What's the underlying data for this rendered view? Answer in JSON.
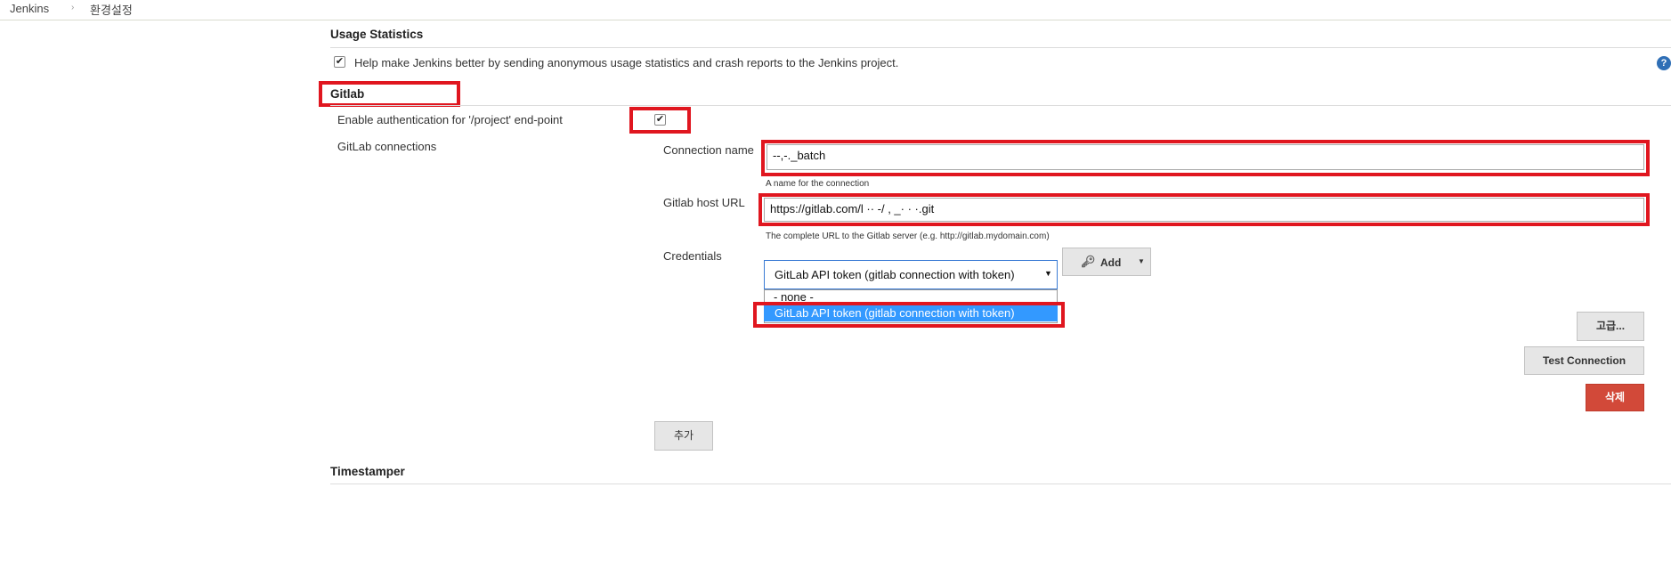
{
  "breadcrumb": {
    "home": "Jenkins",
    "separator": "›",
    "current": "환경설정"
  },
  "usage": {
    "title": "Usage Statistics",
    "checkbox_text": "Help make Jenkins better by sending anonymous usage statistics and crash reports to the Jenkins project.",
    "checked": true,
    "help_icon": "question-icon"
  },
  "gitlab": {
    "title": "Gitlab",
    "enable_auth_label": "Enable authentication for '/project' end-point",
    "enable_auth_checked": true,
    "connections_label": "GitLab connections",
    "connection_name_label": "Connection name",
    "connection_name_value": "--,-._batch",
    "connection_name_help": "A name for the connection",
    "host_url_label": "Gitlab host URL",
    "host_url_value": "https://gitlab.com/l           ·· -/  ,  _· · ·.git",
    "host_url_help": "The complete URL to the Gitlab server (e.g. http://gitlab.mydomain.com)",
    "credentials_label": "Credentials",
    "credentials_selected": "GitLab API token (gitlab connection with token)",
    "credentials_options": [
      "- none -",
      "GitLab API token (gitlab connection with token)"
    ],
    "add_button": "Add",
    "add_icon": "key-icon",
    "advanced_button": "고급...",
    "test_button": "Test Connection",
    "delete_button": "삭제",
    "add_connection_button": "추가"
  },
  "timestamper": {
    "title": "Timestamper"
  },
  "colors": {
    "highlight": "#e0161f",
    "selected_option": "#3399ff",
    "danger": "#d24939"
  }
}
